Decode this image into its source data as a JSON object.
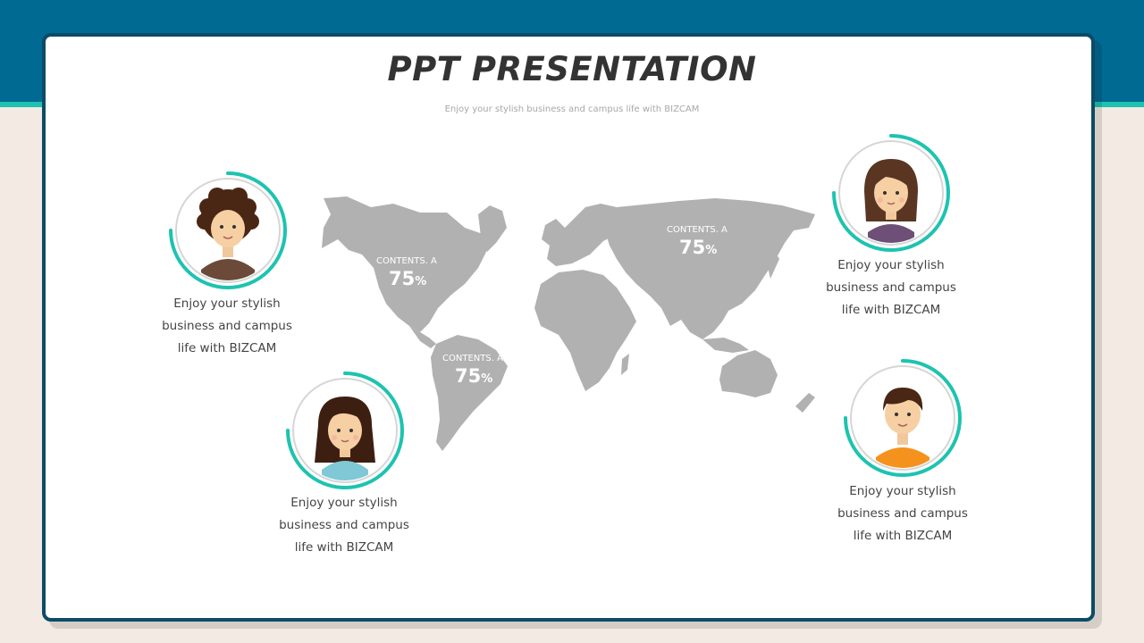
{
  "slide": {
    "title": "PPT PRESENTATION",
    "subtitle": "Enjoy your stylish business and campus life with BIZCAM"
  },
  "colors": {
    "header": "#006a93",
    "accent": "#1dc3b0",
    "border": "#0d4b66",
    "map": "#b1b1b1",
    "background": "#f3ebe3"
  },
  "map_labels": [
    {
      "tag": "CONTENTS. A",
      "value": "75",
      "unit": "%"
    },
    {
      "tag": "CONTENTS. A",
      "value": "75",
      "unit": "%"
    },
    {
      "tag": "CONTENTS. A",
      "value": "75",
      "unit": "%"
    }
  ],
  "profiles": [
    {
      "icon": "man-curly-hair-avatar-icon",
      "line1": "Enjoy your stylish",
      "line2": "business and campus",
      "line3": "life with BIZCAM"
    },
    {
      "icon": "girl-long-hair-avatar-icon",
      "line1": "Enjoy your stylish",
      "line2": "business and campus",
      "line3": "life with BIZCAM"
    },
    {
      "icon": "woman-avatar-icon",
      "line1": "Enjoy your stylish",
      "line2": "business and campus",
      "line3": "life with BIZCAM"
    },
    {
      "icon": "boy-avatar-icon",
      "line1": "Enjoy your stylish",
      "line2": "business and campus",
      "line3": "life with BIZCAM"
    }
  ]
}
